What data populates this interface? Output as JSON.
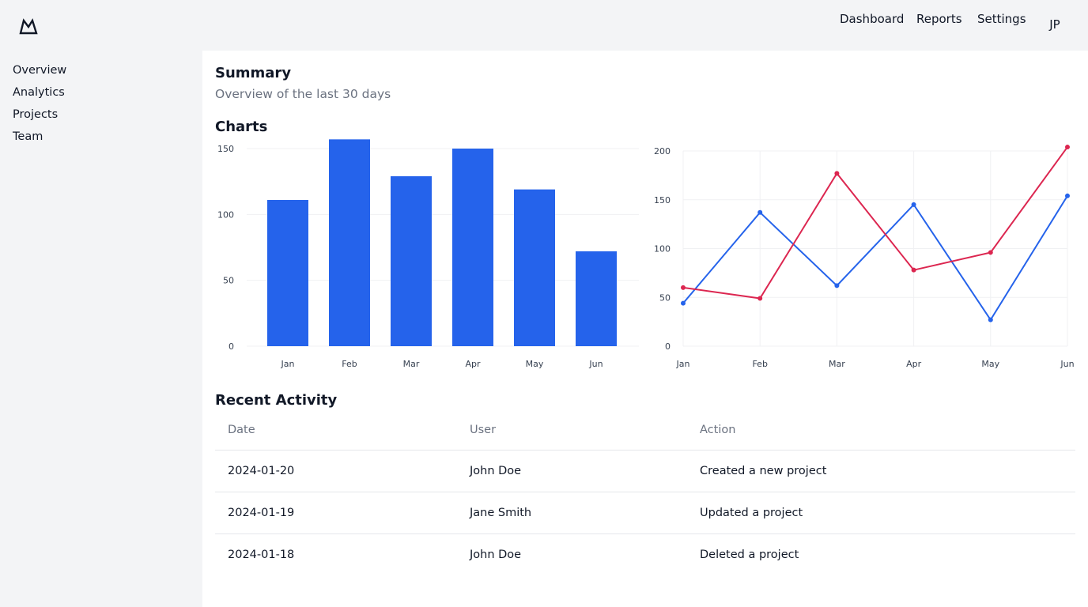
{
  "header": {
    "nav": [
      "Dashboard",
      "Reports",
      "Settings"
    ],
    "avatar_initials": "JP"
  },
  "sidebar": {
    "items": [
      {
        "label": "Overview"
      },
      {
        "label": "Analytics"
      },
      {
        "label": "Projects"
      },
      {
        "label": "Team"
      }
    ]
  },
  "main": {
    "title": "Summary",
    "subtitle": "Overview of the last 30 days",
    "charts_heading": "Charts",
    "activity_heading": "Recent Activity",
    "table": {
      "columns": [
        "Date",
        "User",
        "Action"
      ],
      "rows": [
        [
          "2024-01-20",
          "John Doe",
          "Created a new project"
        ],
        [
          "2024-01-19",
          "Jane Smith",
          "Updated a project"
        ],
        [
          "2024-01-18",
          "John Doe",
          "Deleted a project"
        ]
      ]
    }
  },
  "colors": {
    "bar": "#2563eb",
    "line_blue": "#2563eb",
    "line_red": "#dc2650",
    "grid": "#f0f1f3"
  },
  "chart_data": [
    {
      "type": "bar",
      "categories": [
        "Jan",
        "Feb",
        "Mar",
        "Apr",
        "May",
        "Jun"
      ],
      "values": [
        111,
        157,
        129,
        150,
        119,
        72
      ],
      "ylim": [
        0,
        150
      ],
      "yticks": [
        0,
        50,
        100,
        150
      ],
      "grid": true,
      "legend": "none"
    },
    {
      "type": "line",
      "categories": [
        "Jan",
        "Feb",
        "Mar",
        "Apr",
        "May",
        "Jun"
      ],
      "series": [
        {
          "color": "#2563eb",
          "values": [
            44,
            137,
            62,
            145,
            27,
            154
          ]
        },
        {
          "color": "#dc2650",
          "values": [
            60,
            49,
            177,
            78,
            96,
            204
          ]
        }
      ],
      "ylim": [
        0,
        200
      ],
      "yticks": [
        0,
        50,
        100,
        150,
        200
      ],
      "grid": true,
      "legend": "none"
    }
  ]
}
